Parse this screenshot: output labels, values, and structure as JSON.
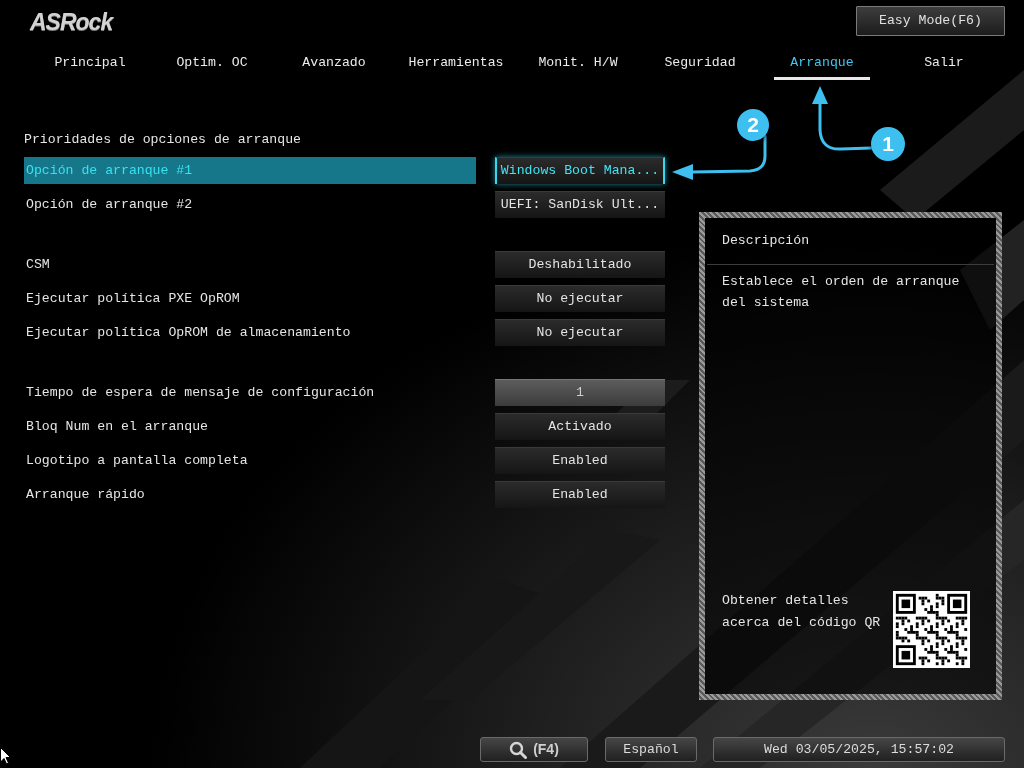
{
  "header": {
    "logo": "ASRock",
    "easy_mode_button": "Easy Mode(F6)"
  },
  "tabs": [
    {
      "label": "Principal",
      "selected": false
    },
    {
      "label": "Optim. OC",
      "selected": false
    },
    {
      "label": "Avanzado",
      "selected": false
    },
    {
      "label": "Herramientas",
      "selected": false
    },
    {
      "label": "Monit. H/W",
      "selected": false
    },
    {
      "label": "Seguridad",
      "selected": false
    },
    {
      "label": "Arranque",
      "selected": true
    },
    {
      "label": "Salir",
      "selected": false
    }
  ],
  "callouts": [
    {
      "number": "1"
    },
    {
      "number": "2"
    }
  ],
  "settings": {
    "sections": [
      {
        "title": "Prioridades de opciones de arranque",
        "items": [
          {
            "label": "Opción de arranque #1",
            "value": "Windows Boot Mana...",
            "kind": "select",
            "selected": true
          },
          {
            "label": "Opción de arranque #2",
            "value": "UEFI: SanDisk Ult...",
            "kind": "select",
            "selected": false
          }
        ]
      },
      {
        "items": [
          {
            "label": "CSM",
            "value": "Deshabilitado",
            "kind": "select",
            "selected": false
          },
          {
            "label": "Ejecutar política PXE OpROM",
            "value": "No ejecutar",
            "kind": "select",
            "selected": false
          },
          {
            "label": "Ejecutar política OpROM de almacenamiento",
            "value": "No ejecutar",
            "kind": "select",
            "selected": false
          }
        ]
      },
      {
        "items": [
          {
            "label": "Tiempo de espera de mensaje de configuración",
            "value": "1",
            "kind": "input",
            "selected": false
          },
          {
            "label": "Bloq Num en el arranque",
            "value": "Activado",
            "kind": "select",
            "selected": false
          },
          {
            "label": "Logotipo a pantalla completa",
            "value": "Enabled",
            "kind": "select",
            "selected": false
          },
          {
            "label": "Arranque rápido",
            "value": "Enabled",
            "kind": "select",
            "selected": false
          }
        ]
      }
    ]
  },
  "description": {
    "title": "Descripción",
    "text": "Establece el orden de arranque del sistema",
    "qr_caption": "Obtener detalles acerca del código QR"
  },
  "footer": {
    "search_key": "(F4)",
    "language": "Español",
    "datetime": "Wed 03/05/2025, 15:57:02"
  }
}
